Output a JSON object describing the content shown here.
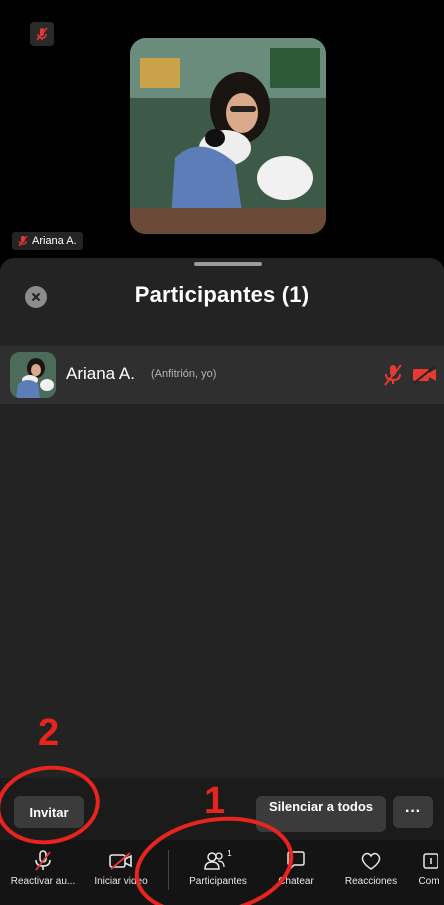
{
  "video": {
    "participant_name": "Ariana A."
  },
  "panel": {
    "title": "Participantes (1)",
    "participants": [
      {
        "name": "Ariana A.",
        "role": "(Anfitrión, yo)"
      }
    ]
  },
  "actions": {
    "invite_label": "Invitar",
    "mute_all_label": "Silenciar a todos",
    "more_label": "···"
  },
  "toolbar": {
    "items": [
      {
        "label": "Reactivar au...",
        "icon": "mic-muted-icon"
      },
      {
        "label": "Iniciar video",
        "icon": "video-off-icon"
      },
      {
        "label": "Participantes",
        "icon": "participants-icon",
        "badge": "1"
      },
      {
        "label": "Chatear",
        "icon": "chat-icon"
      },
      {
        "label": "Reacciones",
        "icon": "heart-icon"
      },
      {
        "label": "Com",
        "icon": "share-icon"
      }
    ]
  },
  "annotations": {
    "marker_1": "1",
    "marker_2": "2"
  },
  "colors": {
    "accent_red": "#e8241f",
    "muted_red": "#e53935",
    "panel_bg": "#232323"
  }
}
